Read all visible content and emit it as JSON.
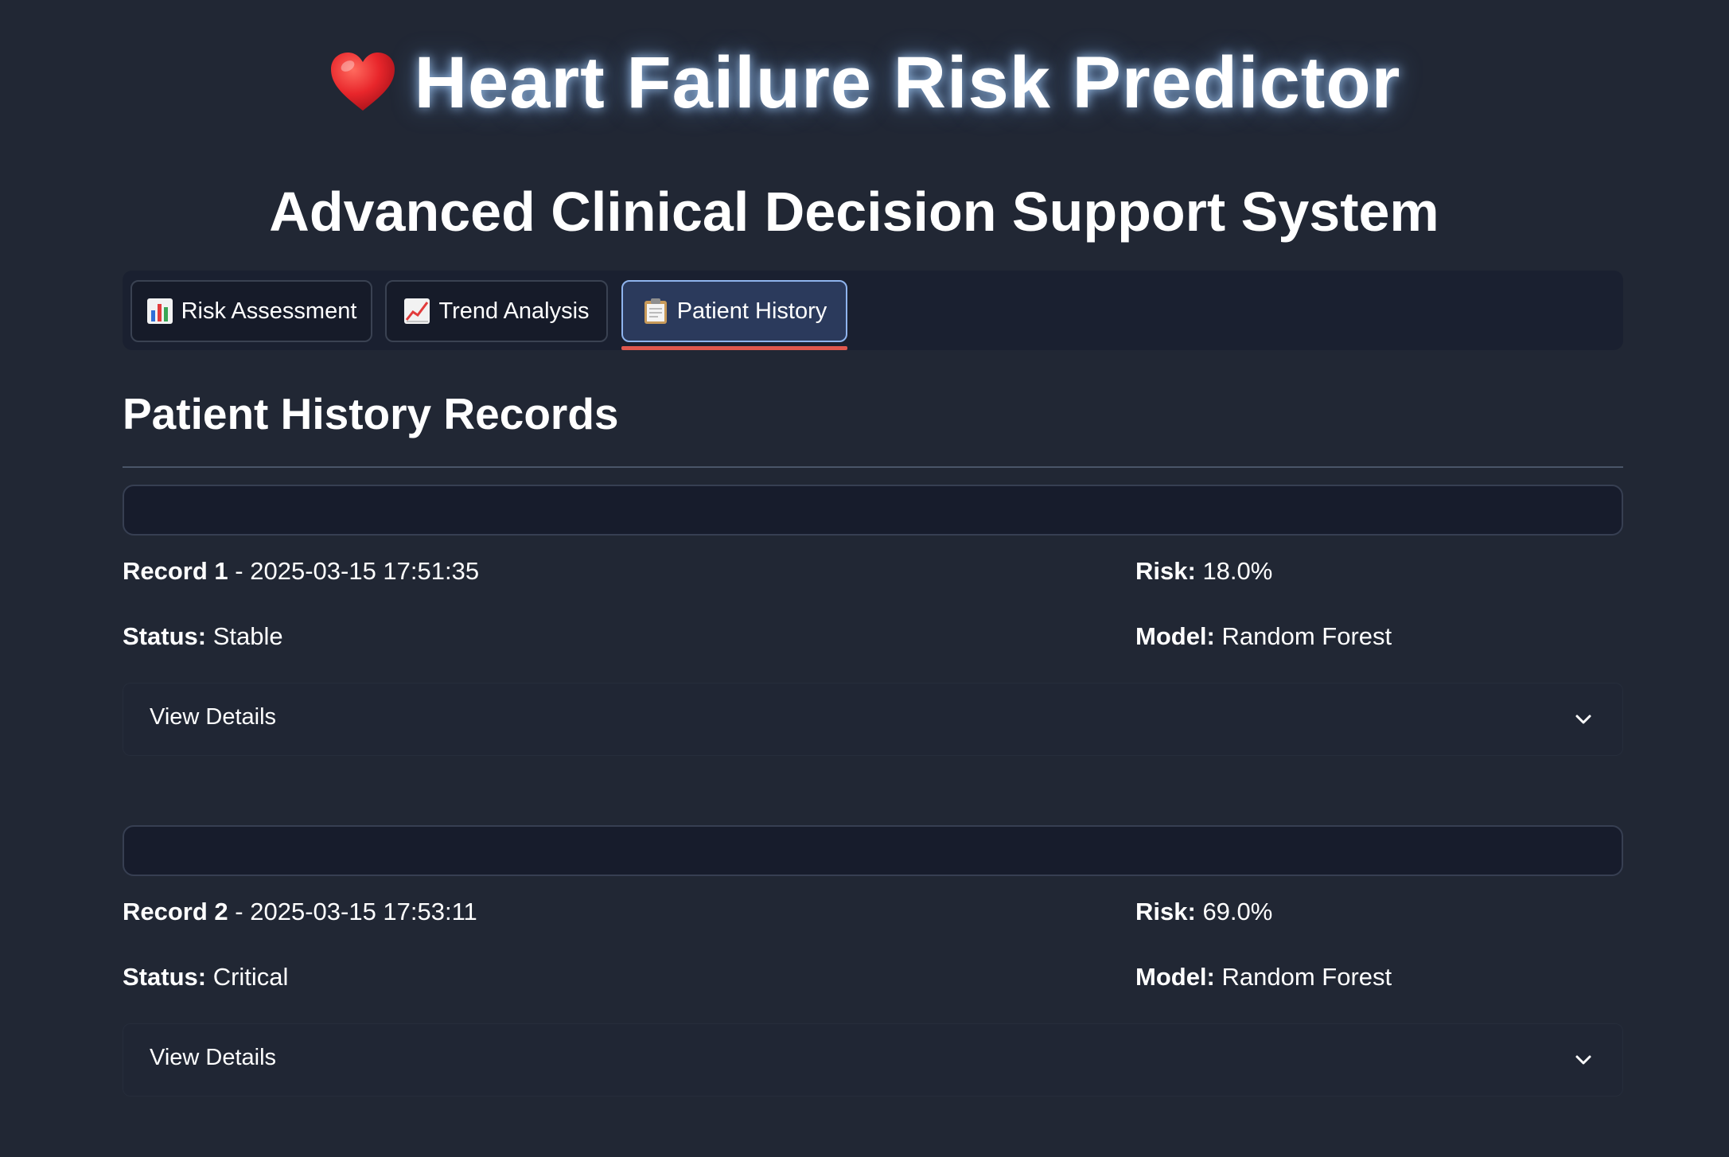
{
  "header": {
    "icon": "heart-emoji",
    "title": "Heart Failure Risk Predictor",
    "subtitle": "Advanced Clinical Decision Support System"
  },
  "tabs": [
    {
      "icon": "bar-chart-icon",
      "label": "Risk Assessment",
      "active": false
    },
    {
      "icon": "trend-chart-icon",
      "label": "Trend Analysis",
      "active": false
    },
    {
      "icon": "clipboard-icon",
      "label": "Patient History",
      "active": true
    }
  ],
  "section": {
    "title": "Patient History Records"
  },
  "records": [
    {
      "record_label": "Record 1",
      "separator": " - ",
      "timestamp": "2025-03-15 17:51:35",
      "risk_label": "Risk:",
      "risk_value": "18.0%",
      "status_label": "Status:",
      "status_value": "Stable",
      "model_label": "Model:",
      "model_value": "Random Forest",
      "details_label": "View Details"
    },
    {
      "record_label": "Record 2",
      "separator": " - ",
      "timestamp": "2025-03-15 17:53:11",
      "risk_label": "Risk:",
      "risk_value": "69.0%",
      "status_label": "Status:",
      "status_value": "Critical",
      "model_label": "Model:",
      "model_value": "Random Forest",
      "details_label": "View Details"
    }
  ],
  "colors": {
    "background": "#212734",
    "active_tab_underline": "#e0584e",
    "active_tab_bg": "#2b3a5c",
    "heart": "#e8262b"
  }
}
